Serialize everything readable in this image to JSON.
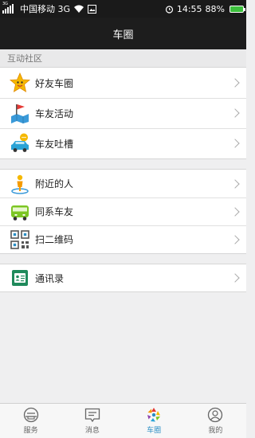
{
  "status": {
    "network_tag": "3G",
    "carrier": "中国移动 3G",
    "time": "14:55",
    "battery": "88%"
  },
  "header": {
    "title": "车圈"
  },
  "section_label": "互动社区",
  "groups": [
    [
      {
        "label": "好友车圈",
        "icon": "star-face-icon"
      },
      {
        "label": "车友活动",
        "icon": "flag-map-icon"
      },
      {
        "label": "车友吐槽",
        "icon": "chat-car-icon"
      }
    ],
    [
      {
        "label": "附近的人",
        "icon": "location-person-icon"
      },
      {
        "label": "同系车友",
        "icon": "bus-icon"
      },
      {
        "label": "扫二维码",
        "icon": "qr-code-icon"
      }
    ],
    [
      {
        "label": "通讯录",
        "icon": "contacts-icon"
      }
    ]
  ],
  "tabs": [
    {
      "label": "服务",
      "icon": "service-icon",
      "active": false
    },
    {
      "label": "消息",
      "icon": "message-icon",
      "active": false
    },
    {
      "label": "车圈",
      "icon": "car-circle-icon",
      "active": true
    },
    {
      "label": "我的",
      "icon": "profile-icon",
      "active": false
    }
  ],
  "colors": {
    "accent": "#2a8ec4",
    "titlebar": "#1d1d1d"
  }
}
